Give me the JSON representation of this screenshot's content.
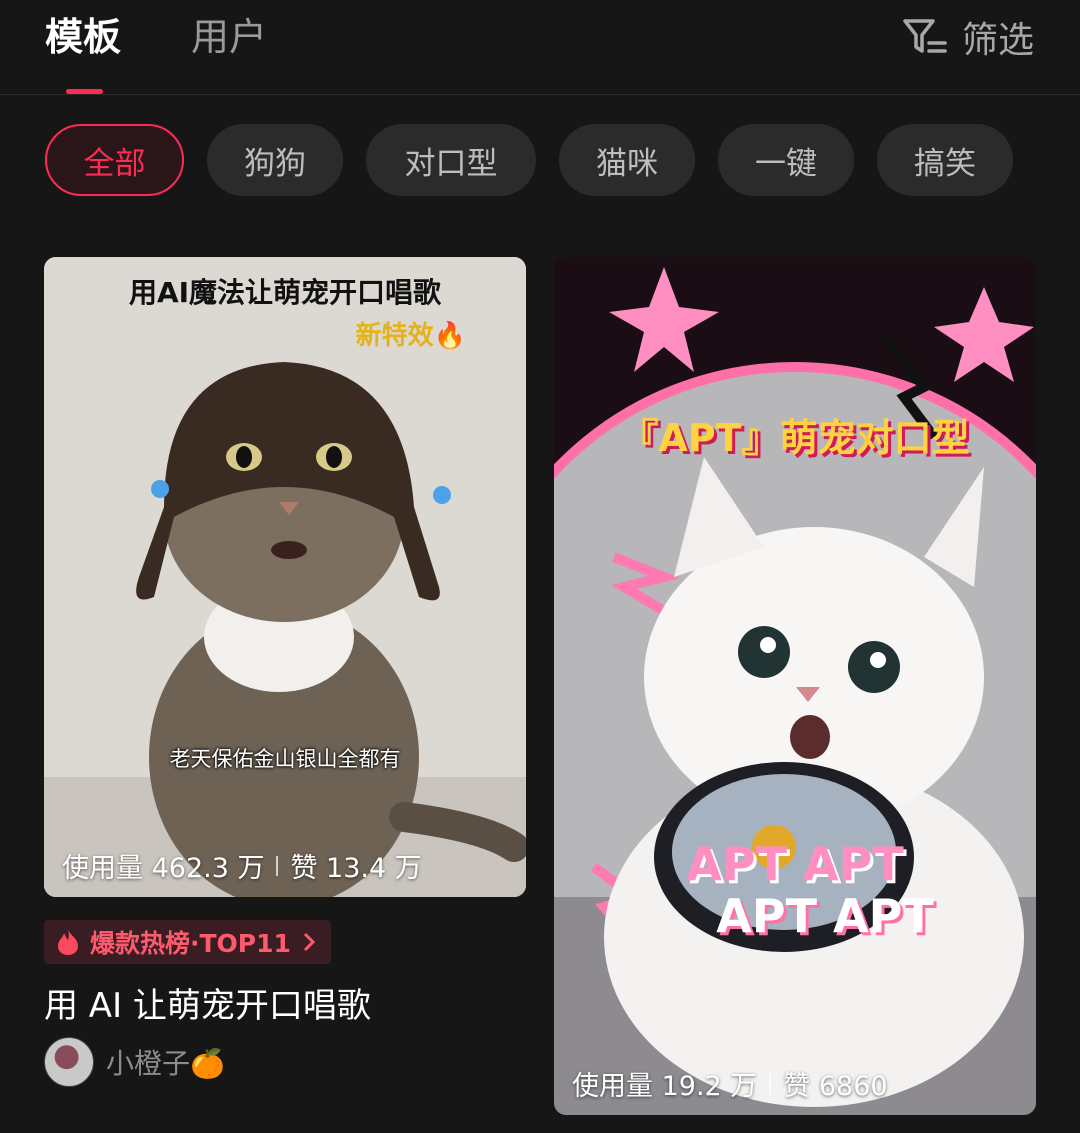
{
  "tabs": [
    {
      "label": "模板",
      "active": true
    },
    {
      "label": "用户",
      "active": false
    }
  ],
  "filter": {
    "label": "筛选",
    "icon": "filter-icon"
  },
  "chips": [
    {
      "label": "全部",
      "active": true
    },
    {
      "label": "狗狗",
      "active": false
    },
    {
      "label": "对口型",
      "active": false
    },
    {
      "label": "猫咪",
      "active": false
    },
    {
      "label": "一键",
      "active": false
    },
    {
      "label": "搞笑",
      "active": false
    }
  ],
  "cards": [
    {
      "overlay_title": "用AI魔法让萌宠开口唱歌",
      "overlay_tag": "新特效🔥",
      "subtitle": "老天保佑金山银山全都有",
      "stats": {
        "usage": "使用量 462.3 万",
        "likes": "赞 13.4 万"
      },
      "rank_badge": "爆款热榜·TOP11",
      "title": "用 AI 让萌宠开口唱歌",
      "author": "小橙子🍊"
    },
    {
      "overlay_title": "『APT』萌宠对口型",
      "overlay_text_1": "APT APT",
      "overlay_text_2": "APT APT",
      "stats": {
        "usage": "使用量 19.2 万",
        "likes": "赞 6860"
      }
    }
  ],
  "colors": {
    "accent": "#fe2c55",
    "background": "#161616"
  }
}
